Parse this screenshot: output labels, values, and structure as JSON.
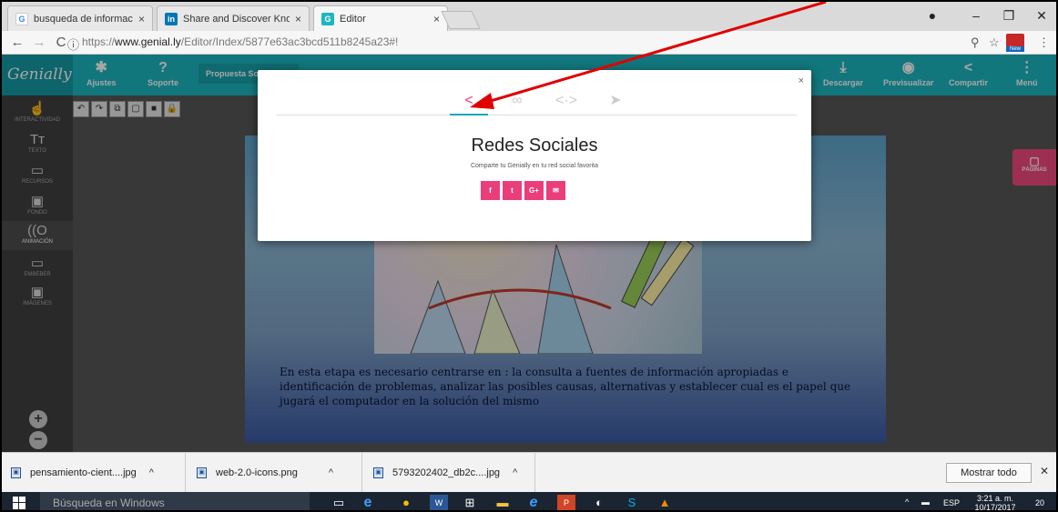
{
  "browser": {
    "tabs": [
      {
        "label": "busqueda de informacio",
        "icon": "google-favicon-icon",
        "color": "#4285f4"
      },
      {
        "label": "Share and Discover Know",
        "icon": "linkedin-favicon-icon",
        "color": "#0077b5"
      },
      {
        "label": "Editor",
        "icon": "genially-favicon-icon",
        "color": "#1db6c0"
      }
    ],
    "url_prefix": "https://",
    "url_host": "www.genial.ly",
    "url_path": "/Editor/Index/5877e63ac3bcd511b8245a23#!",
    "ext_badge": "New"
  },
  "genially": {
    "logo": "Genially",
    "top_buttons": {
      "ajustes": "Ajustes",
      "soporte": "Soporte",
      "descargar": "Descargar",
      "previsualizar": "Previsualizar",
      "compartir": "Compartir",
      "menu": "Menú"
    },
    "project_title": "Propuesta Sof",
    "sidebar": [
      {
        "label": "INTERACTIVIDAD",
        "icon": "interactivity-icon",
        "glyph": "☝"
      },
      {
        "label": "TEXTO",
        "icon": "text-icon",
        "glyph": "Tт"
      },
      {
        "label": "RECURSOS",
        "icon": "resources-icon",
        "glyph": "▭"
      },
      {
        "label": "FONDO",
        "icon": "background-icon",
        "glyph": "▣"
      },
      {
        "label": "ANIMACIÓN",
        "icon": "animation-icon",
        "glyph": "((O"
      },
      {
        "label": "EMBEBER",
        "icon": "embed-icon",
        "glyph": "▭"
      },
      {
        "label": "IMÁGENES",
        "icon": "images-icon",
        "glyph": "▣"
      }
    ],
    "paginas": "PÁGINAS",
    "slide_text": "En esta etapa es necesario centrarse en : la consulta a fuentes de información apropiadas e identificación de problemas, analizar las posibles causas, alternativas y establecer cual es el papel que jugará el computador en la solución del mismo"
  },
  "modal": {
    "title": "Redes Sociales",
    "subtitle": "Comparte tu Genially en tu red social favorita",
    "close": "×",
    "social_buttons": [
      {
        "label": "f",
        "name": "facebook-share-button"
      },
      {
        "label": "t",
        "name": "twitter-share-button"
      },
      {
        "label": "G+",
        "name": "googleplus-share-button"
      },
      {
        "label": "✉",
        "name": "email-share-button"
      }
    ],
    "accent": "#ea3e7b"
  },
  "downloads": {
    "files": [
      "pensamiento-cient....jpg",
      "web-2.0-icons.png",
      "5793202402_db2c....jpg"
    ],
    "show_all": "Mostrar todo"
  },
  "taskbar": {
    "search": "Búsqueda en Windows",
    "lang": "ESP",
    "time": "3:21 a. m.",
    "date": "10/17/2017",
    "notifications": "20"
  }
}
